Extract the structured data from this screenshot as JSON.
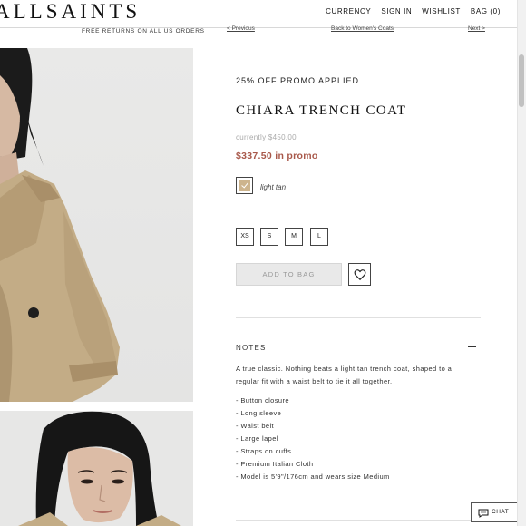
{
  "header": {
    "logo": "ALLSAINTS",
    "nav": [
      "CURRENCY",
      "SIGN IN",
      "WISHLIST",
      "BAG (0)"
    ],
    "free_returns": "FREE RETURNS ON ALL US ORDERS"
  },
  "breadcrumbs": {
    "previous": "< Previous",
    "back": "Back to Women's Coats",
    "next": "Next >"
  },
  "product": {
    "promo_banner": "25% OFF PROMO APPLIED",
    "title": "CHIARA TRENCH COAT",
    "was_price": "currently $450.00",
    "promo_price": "$337.50 in promo",
    "color": {
      "name": "light tan",
      "hex": "#cdb48d"
    },
    "sizes": [
      "XS",
      "S",
      "M",
      "L"
    ],
    "add_to_bag": "ADD TO BAG",
    "wishlist_icon": "heart-icon"
  },
  "notes": {
    "heading": "NOTES",
    "description": "A true classic. Nothing beats a light tan trench coat, shaped to a regular fit with a waist belt to tie it all together.",
    "features": [
      "- Button closure",
      "- Long sleeve",
      "- Waist belt",
      "- Large lapel",
      "- Straps on cuffs",
      "- Premium Italian Cloth",
      "- Model is 5'9\"/176cm and wears size Medium"
    ]
  },
  "chat": {
    "label": "CHAT",
    "icon": "chat-bubble-icon"
  },
  "colors": {
    "price_accent": "#a8584a",
    "coat": "#c3ac86"
  }
}
